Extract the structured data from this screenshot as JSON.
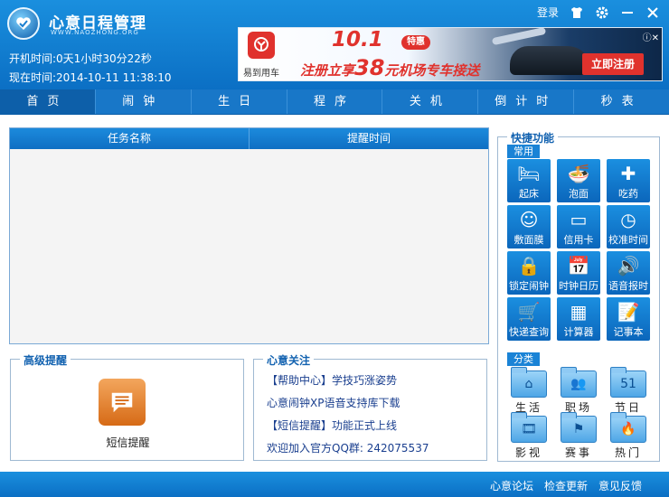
{
  "header": {
    "title": "心意日程管理",
    "subtitle": "WWW.NAOZHONG.ORG",
    "uptime_label": "开机时间:",
    "uptime_value": "0天1小时30分22秒",
    "now_label": "现在时间:",
    "now_value": "2014-10-11 11:38:10",
    "login": "登录"
  },
  "ad": {
    "brand": "易到用车",
    "big": "10.1",
    "tag": "特惠",
    "line_a": "注册立享",
    "line_num": "38",
    "line_b": "元机场专车接送",
    "button": "立即注册"
  },
  "tabs": [
    "首页",
    "闹钟",
    "生日",
    "程序",
    "关机",
    "倒计时",
    "秒表"
  ],
  "tasks": {
    "col_name": "任务名称",
    "col_time": "提醒时间"
  },
  "advanced": {
    "title": "高级提醒",
    "sms_label": "短信提醒"
  },
  "focus": {
    "title": "心意关注",
    "links": [
      "【帮助中心】学技巧涨姿势",
      "心意闹钟XP语音支持库下载",
      "【短信提醒】功能正式上线",
      "欢迎加入官方QQ群: 242075537"
    ]
  },
  "quick": {
    "title": "快捷功能",
    "common_label": "常用",
    "category_label": "分类",
    "common": [
      {
        "label": "起床",
        "icon": "bed-icon"
      },
      {
        "label": "泡面",
        "icon": "noodle-icon"
      },
      {
        "label": "吃药",
        "icon": "medicine-icon"
      },
      {
        "label": "敷面膜",
        "icon": "mask-icon"
      },
      {
        "label": "信用卡",
        "icon": "card-icon"
      },
      {
        "label": "校准时间",
        "icon": "clock-icon"
      },
      {
        "label": "锁定闹钟",
        "icon": "lock-icon"
      },
      {
        "label": "时钟日历",
        "icon": "calendar-icon"
      },
      {
        "label": "语音报时",
        "icon": "speaker-icon"
      },
      {
        "label": "快递查询",
        "icon": "cart-icon"
      },
      {
        "label": "计算器",
        "icon": "calculator-icon"
      },
      {
        "label": "记事本",
        "icon": "notepad-icon"
      }
    ],
    "categories": [
      {
        "label": "生活",
        "icon": "house-icon"
      },
      {
        "label": "职场",
        "icon": "people-icon"
      },
      {
        "label": "节日",
        "icon": "calendar-51-icon",
        "badge": "51"
      },
      {
        "label": "影视",
        "icon": "film-icon"
      },
      {
        "label": "赛事",
        "icon": "flag-icon"
      },
      {
        "label": "热门",
        "icon": "fire-icon"
      }
    ]
  },
  "footer": {
    "links": [
      "心意论坛",
      "检查更新",
      "意见反馈"
    ]
  }
}
